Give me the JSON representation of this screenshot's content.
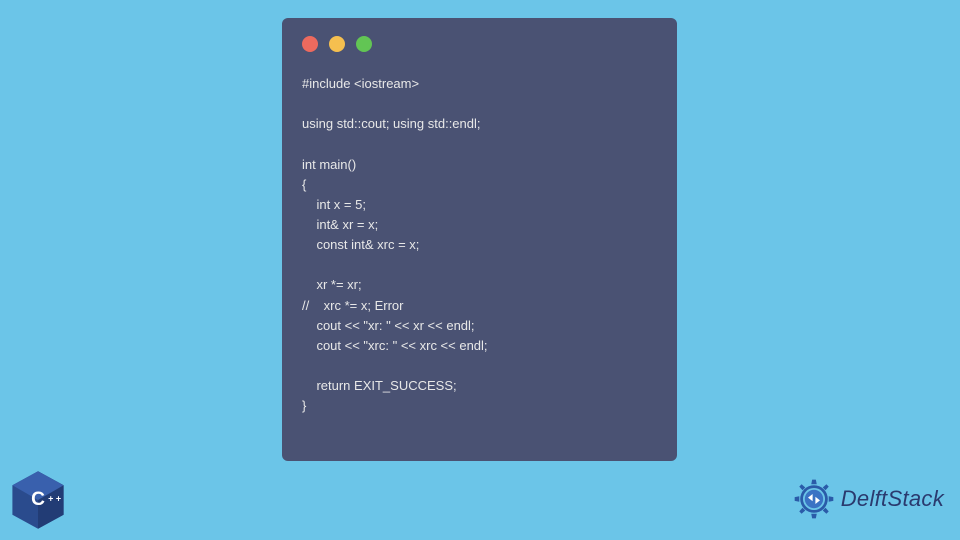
{
  "code": {
    "line1": "#include <iostream>",
    "line2": "",
    "line3": "using std::cout; using std::endl;",
    "line4": "",
    "line5": "int main()",
    "line6": "{",
    "line7": "    int x = 5;",
    "line8": "    int& xr = x;",
    "line9": "    const int& xrc = x;",
    "line10": "",
    "line11": "    xr *= xr;",
    "line12": "//    xrc *= x; Error",
    "line13": "    cout << \"xr: \" << xr << endl;",
    "line14": "    cout << \"xrc: \" << xrc << endl;",
    "line15": "",
    "line16": "    return EXIT_SUCCESS;",
    "line17": "}"
  },
  "logos": {
    "cpp_label": "C++",
    "delft_text": "DelftStack"
  },
  "colors": {
    "background": "#6bc5e8",
    "window": "#4a5273",
    "code_text": "#e8e8e8",
    "red": "#ed6a5e",
    "yellow": "#f5bf4f",
    "green": "#62c554",
    "cpp_blue": "#274389",
    "delft_blue": "#2a3a6e"
  }
}
